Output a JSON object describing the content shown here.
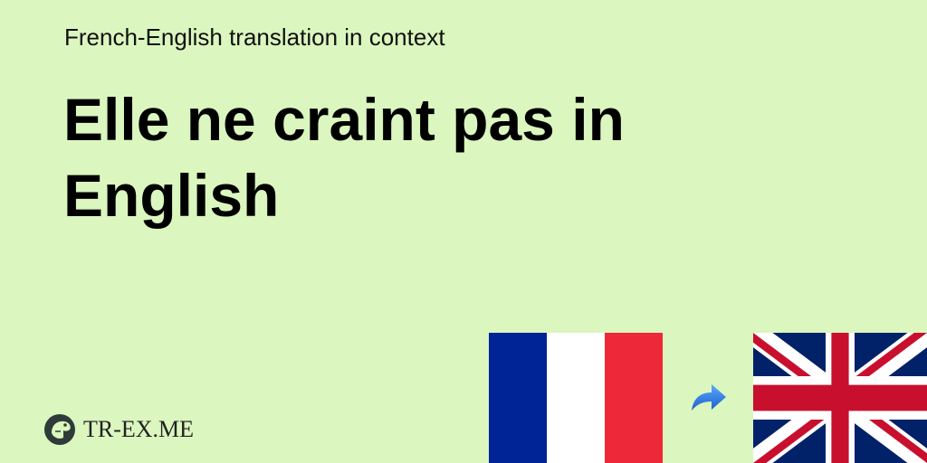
{
  "header": {
    "subtitle": "French-English translation in context",
    "title": "Elle ne craint pas in English"
  },
  "brand": {
    "name": "TR-EX.ME",
    "logo_icon": "dinosaur-head-icon"
  },
  "flags": {
    "source": "france-flag-icon",
    "arrow": "curved-arrow-right-icon",
    "target": "uk-flag-icon"
  },
  "colors": {
    "background": "#dbf6bf",
    "fr_blue": "#002395",
    "fr_red": "#ed2939",
    "uk_blue": "#012169",
    "uk_red": "#c8102e",
    "arrow_blue": "#2b78e4"
  }
}
